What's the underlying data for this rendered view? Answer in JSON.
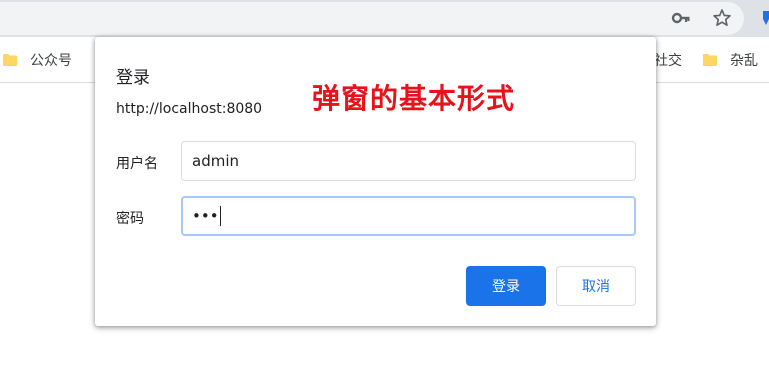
{
  "browser": {
    "key_icon": "key-icon",
    "bookmark_star_icon": "star-icon"
  },
  "bookmarks": [
    {
      "label": "公众号",
      "icon": "folder-icon"
    },
    {
      "label": "社交",
      "icon": "folder-icon"
    },
    {
      "label": "杂乱",
      "icon": "folder-icon"
    }
  ],
  "dialog": {
    "title": "登录",
    "origin": "http://localhost:8080",
    "annotation": "弹窗的基本形式",
    "username_label": "用户名",
    "username_value": "admin",
    "password_label": "密码",
    "password_mask": "•••",
    "login_button": "登录",
    "cancel_button": "取消"
  },
  "colors": {
    "accent": "#1a73e8",
    "annotation": "#e8131a",
    "folder": "#fdd663"
  }
}
